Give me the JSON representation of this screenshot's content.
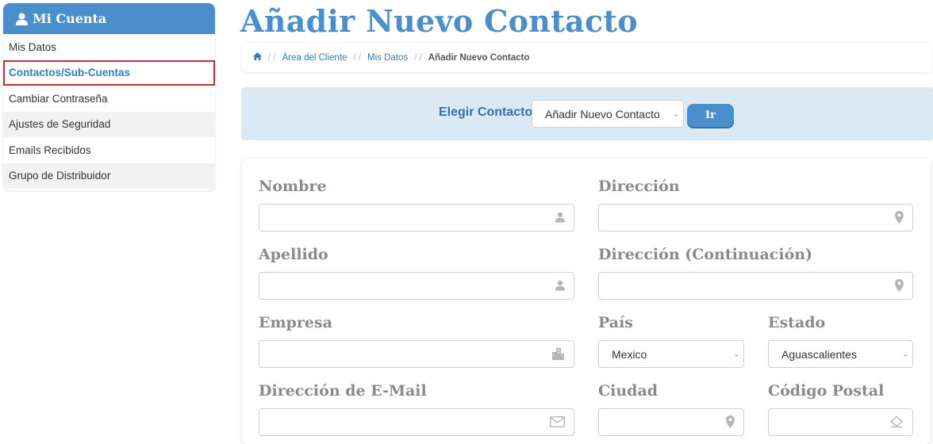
{
  "sidebar": {
    "title": "Mi Cuenta",
    "items": [
      {
        "label": "Mis Datos"
      },
      {
        "label": "Contactos/Sub-Cuentas"
      },
      {
        "label": "Cambiar Contraseña"
      },
      {
        "label": "Ajustes de Seguridad"
      },
      {
        "label": "Emails Recibidos"
      },
      {
        "label": "Grupo de Distribuidor"
      }
    ]
  },
  "page": {
    "title": "Añadir Nuevo Contacto"
  },
  "breadcrumb": {
    "items": [
      "Área del Cliente",
      "Mis Datos"
    ],
    "current": "Añadir Nuevo Contacto"
  },
  "choose": {
    "label": "Elegir Contacto",
    "selected": "Añadir Nuevo Contacto",
    "button": "Ir"
  },
  "form": {
    "nombre": {
      "label": "Nombre",
      "value": ""
    },
    "apellido": {
      "label": "Apellido",
      "value": ""
    },
    "empresa": {
      "label": "Empresa",
      "value": ""
    },
    "email": {
      "label": "Dirección de E-Mail",
      "value": ""
    },
    "direccion": {
      "label": "Dirección",
      "value": ""
    },
    "direccion2": {
      "label": "Dirección (Continuación)",
      "value": ""
    },
    "pais": {
      "label": "País",
      "selected": "Mexico"
    },
    "estado": {
      "label": "Estado",
      "selected": "Aguascalientes"
    },
    "ciudad": {
      "label": "Ciudad",
      "value": ""
    },
    "codigo_postal": {
      "label": "Código Postal",
      "value": ""
    }
  },
  "icons": {
    "user": "user-icon",
    "building": "building-icon",
    "envelope": "envelope-icon",
    "map_marker": "map-marker-icon",
    "home": "home-icon"
  },
  "colors": {
    "brand": "#4a8fcb",
    "link": "#2f7fc1",
    "choose_bg": "#dbe9f5",
    "active_border": "#c9302c"
  }
}
